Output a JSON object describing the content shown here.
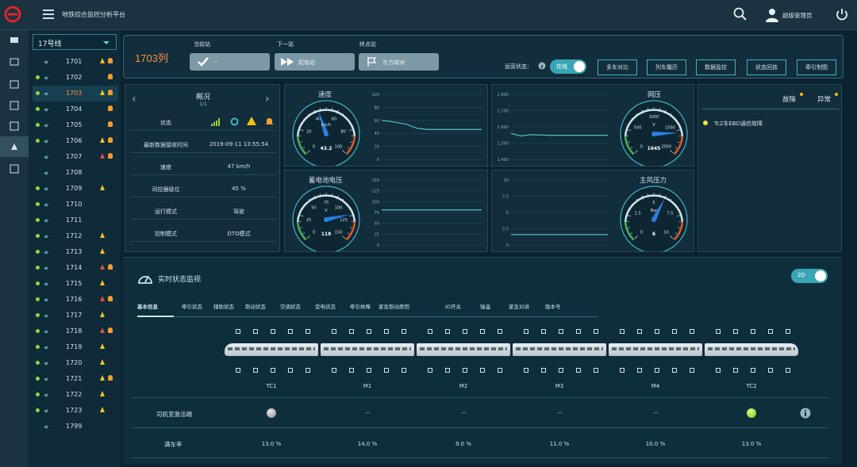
{
  "app": {
    "title": "地铁综合监控分析平台",
    "user": "超级管理员"
  },
  "colors": {
    "accent": "#3fb6c4",
    "warning": "#f1c40f",
    "alarm": "#e74c3c",
    "orange": "#ff8f3c"
  },
  "line_select": {
    "value": "17号线"
  },
  "trains": [
    {
      "num": "1701",
      "dot": false,
      "warn": "y",
      "bell": true
    },
    {
      "num": "1702",
      "dot": true,
      "warn": "",
      "bell": true
    },
    {
      "num": "1703",
      "dot": true,
      "warn": "y",
      "bell": true,
      "selected": true
    },
    {
      "num": "1704",
      "dot": true,
      "warn": "",
      "bell": true
    },
    {
      "num": "1705",
      "dot": true,
      "warn": "",
      "bell": true
    },
    {
      "num": "1706",
      "dot": true,
      "warn": "y",
      "bell": true
    },
    {
      "num": "1707",
      "dot": false,
      "warn": "r",
      "bell": true
    },
    {
      "num": "1708",
      "dot": false,
      "warn": "",
      "bell": false
    },
    {
      "num": "1709",
      "dot": true,
      "warn": "y",
      "bell": false
    },
    {
      "num": "1710",
      "dot": true,
      "warn": "",
      "bell": false
    },
    {
      "num": "1711",
      "dot": true,
      "warn": "",
      "bell": false
    },
    {
      "num": "1712",
      "dot": true,
      "warn": "y",
      "bell": false
    },
    {
      "num": "1713",
      "dot": true,
      "warn": "y",
      "bell": false
    },
    {
      "num": "1714",
      "dot": true,
      "warn": "r",
      "bell": true
    },
    {
      "num": "1715",
      "dot": true,
      "warn": "y",
      "bell": false
    },
    {
      "num": "1716",
      "dot": true,
      "warn": "r",
      "bell": true
    },
    {
      "num": "1717",
      "dot": true,
      "warn": "y",
      "bell": false
    },
    {
      "num": "1718",
      "dot": true,
      "warn": "r",
      "bell": true
    },
    {
      "num": "1719",
      "dot": true,
      "warn": "y",
      "bell": false
    },
    {
      "num": "1720",
      "dot": true,
      "warn": "y",
      "bell": false
    },
    {
      "num": "1721",
      "dot": true,
      "warn": "y",
      "bell": true
    },
    {
      "num": "1722",
      "dot": true,
      "warn": "y",
      "bell": false
    },
    {
      "num": "1723",
      "dot": true,
      "warn": "y",
      "bell": false
    },
    {
      "num": "1799",
      "dot": false,
      "warn": "",
      "bell": false
    }
  ],
  "header": {
    "train_id": "1703列",
    "current_label": "当前站",
    "current_value": "--",
    "next_label": "下一站",
    "next_value": "起始站",
    "terminal_label": "终点站",
    "terminal_value": "东方绿洲",
    "online_label": "运营状态：",
    "online_toggle": "在线",
    "buttons": [
      "多车对比",
      "列车履历",
      "数据监控",
      "状态回放",
      "牵引制图"
    ]
  },
  "overview": {
    "title": "概况",
    "sub": "1/1",
    "rows": [
      {
        "k": "状态",
        "v": ""
      },
      {
        "k": "最新数据接收时间",
        "v": "2019-09-11 13:55:54"
      },
      {
        "k": "速度",
        "v": "47 km/h"
      },
      {
        "k": "司控器级位",
        "v": "45 %"
      },
      {
        "k": "运行模式",
        "v": "驾驶"
      },
      {
        "k": "控制模式",
        "v": "DTO模式"
      }
    ]
  },
  "gauges": {
    "speed": {
      "title": "速度",
      "unit": "km/h",
      "value": "43.2",
      "ticks": [
        "0",
        "20",
        "40",
        "60",
        "80",
        "100"
      ],
      "y_ticks": [
        "100",
        "80",
        "60",
        "40",
        "20",
        "0"
      ]
    },
    "battery": {
      "title": "蓄电池电压",
      "unit": "V",
      "value": "118",
      "ticks": [
        "0",
        "25",
        "50",
        "75",
        "100",
        "125",
        "150"
      ],
      "y_ticks": [
        "150",
        "125",
        "100",
        "75",
        "50",
        "25",
        "0"
      ]
    },
    "network": {
      "title": "网压",
      "unit": "V",
      "value": "1645",
      "ticks": [
        "0",
        "500",
        "1000",
        "1500",
        "2000"
      ],
      "y_ticks": [
        "1,800",
        "1,700",
        "1,600",
        "1,500",
        "1,400"
      ]
    },
    "air": {
      "title": "主风压力",
      "unit": "Bar",
      "value": "6",
      "ticks": [
        "0",
        "2.5",
        "5",
        "7.5",
        "10"
      ],
      "y_ticks": [
        "10",
        "7.5",
        "5",
        "2.5",
        "0"
      ]
    }
  },
  "fault": {
    "tab_fault": "故障",
    "tab_abnormal": "异常",
    "item": "Tc2车EBD通信故障"
  },
  "realtime": {
    "title": "实时状态监视",
    "toggle": "2D",
    "tabs": [
      "基本信息",
      "牵引状态",
      "辅助状态",
      "制动状态",
      "空调状态",
      "受电状态",
      "牵引故障",
      "紧急制动原因",
      "IO开关",
      "轴温",
      "紧急对讲",
      "版本号"
    ],
    "cars": [
      "TC1",
      "M1",
      "M2",
      "M3",
      "M4",
      "TC2"
    ],
    "row1_label": "司机室激活端",
    "row1_values": [
      "",
      "--",
      "--",
      "--",
      "--",
      ""
    ],
    "row2_label": "满车率",
    "row2_values": [
      "13.0 %",
      "14.0 %",
      "9.0 %",
      "11.0 %",
      "10.0 %",
      "13.0 %"
    ]
  }
}
